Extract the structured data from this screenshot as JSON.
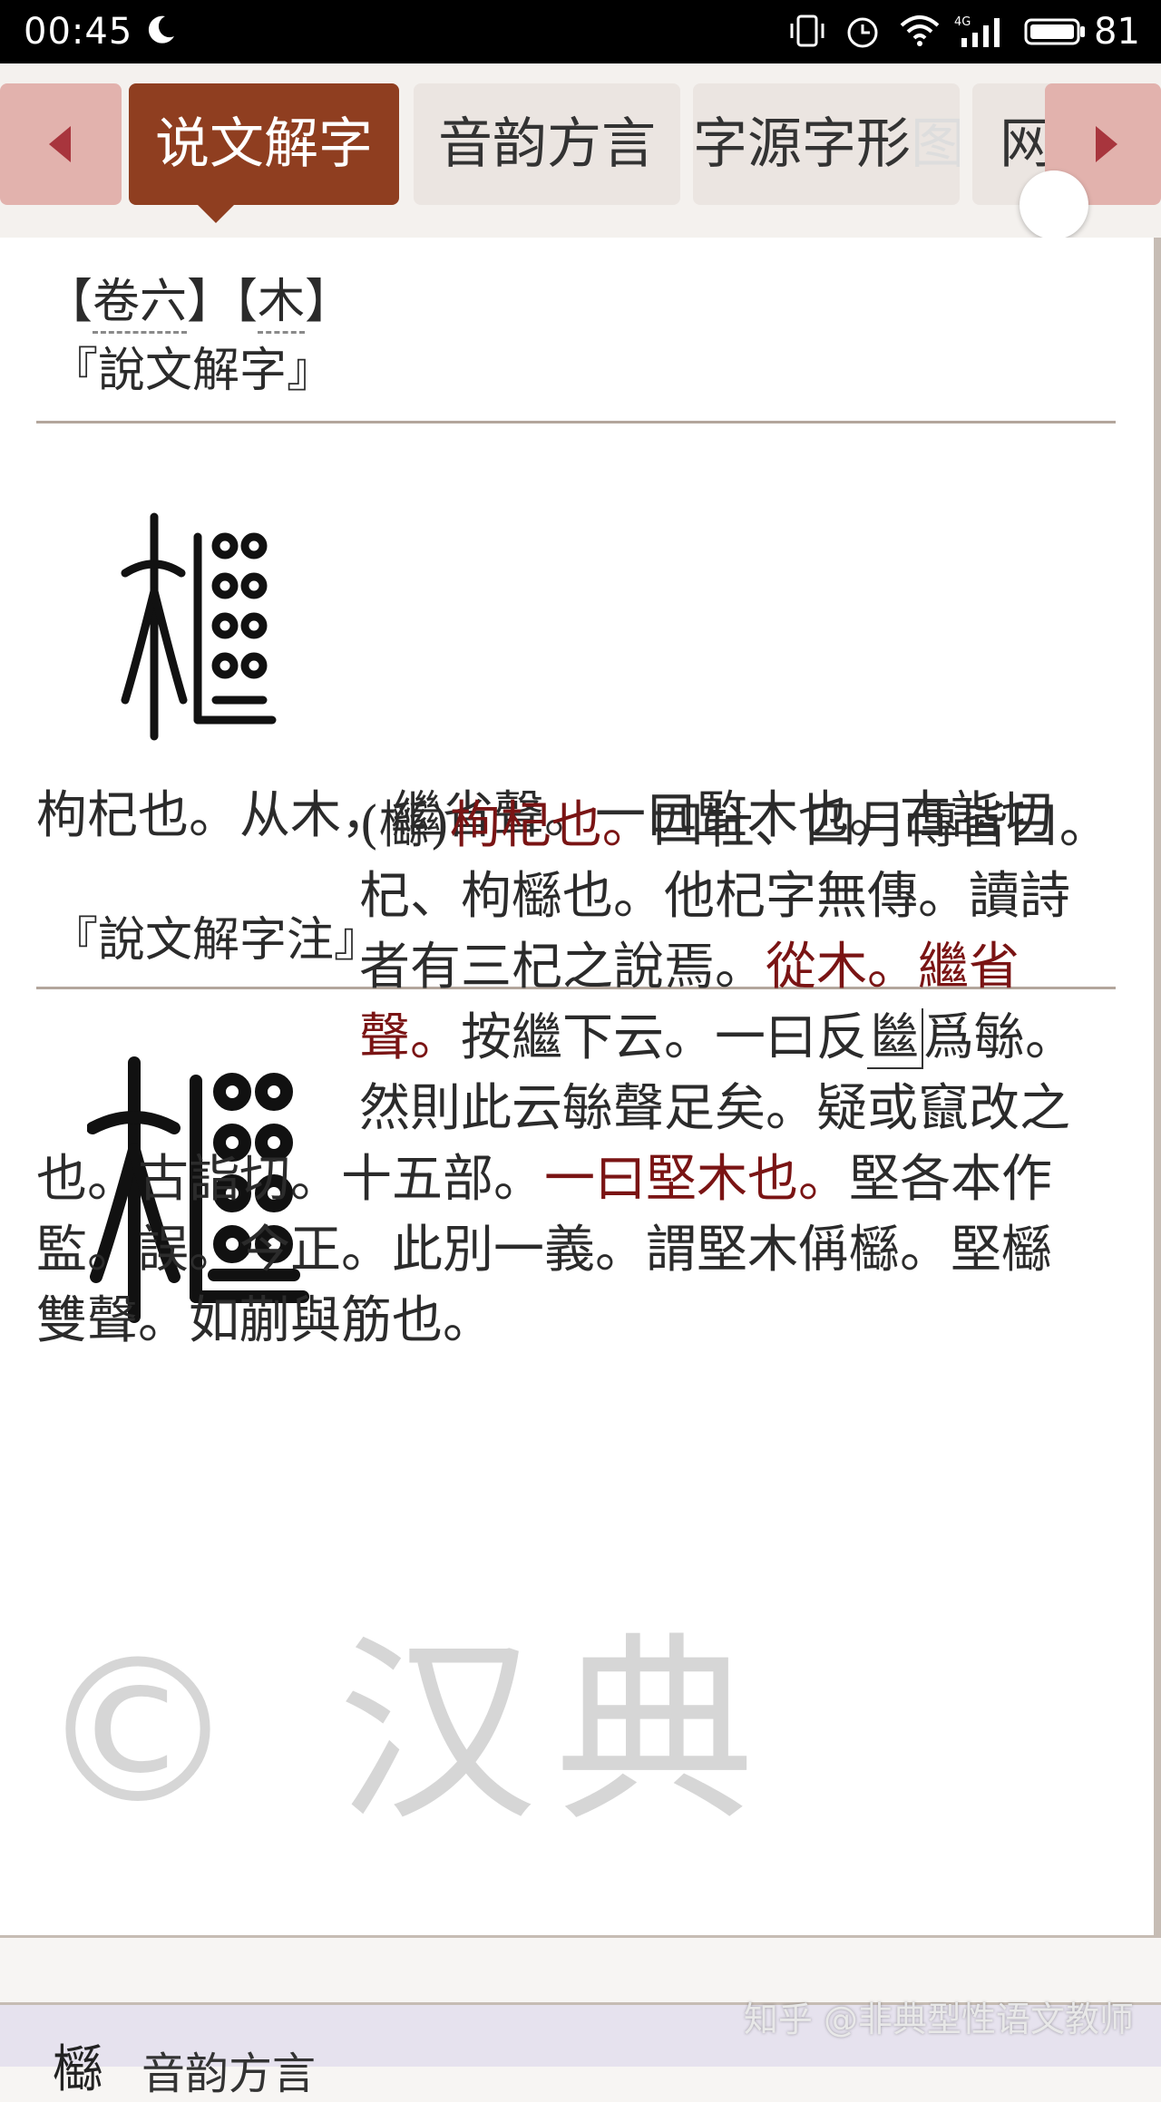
{
  "status_bar": {
    "time": "00:45",
    "battery": "81",
    "network_label": "4G",
    "icons": [
      "moon-icon",
      "vibrate-icon",
      "alarm-icon",
      "wifi-icon",
      "signal-icon",
      "battery-icon"
    ]
  },
  "tabs": {
    "items": [
      {
        "label": "说文解字",
        "active": true
      },
      {
        "label": "音韵方言",
        "active": false
      },
      {
        "label": "字源字形",
        "active": false
      },
      {
        "label": "图",
        "active": false
      },
      {
        "label": "网",
        "active": false
      }
    ],
    "prev_icon": "chevron-left-icon",
    "next_icon": "chevron-right-icon"
  },
  "entry": {
    "breadcrumb": {
      "juan": "卷六",
      "radical": "木"
    },
    "shuowen_title": "『說文解字』",
    "seal_char": "櫾",
    "definition": "枸杞也。从木，繼省聲。一曰監木也。古詣切",
    "zhu_title": "『說文解字注』",
    "zhu_lines": [
      [
        {
          "t": "(櫾)",
          "red": false
        },
        {
          "t": "枸杞也。",
          "red": true
        },
        {
          "t": "四牡、四月傳皆曰。",
          "red": false
        }
      ],
      [
        {
          "t": "杞、枸櫾也。他杞字無傳。讀詩",
          "red": false
        }
      ],
      [
        {
          "t": "者有三杞之說焉。",
          "red": false
        },
        {
          "t": "從木。繼省",
          "red": true
        }
      ],
      [
        {
          "t": "聲。",
          "red": true
        },
        {
          "t": "按繼下云。一曰反",
          "red": false
        },
        {
          "t": "㡭",
          "red": false,
          "boxed": true
        },
        {
          "t": "爲",
          "red": false
        },
        {
          "t": "䋣",
          "red": false
        },
        {
          "t": "。",
          "red": false
        }
      ],
      [
        {
          "t": "然則此云",
          "red": false
        },
        {
          "t": "䋣",
          "red": false
        },
        {
          "t": "聲足矣。疑或竄改之",
          "red": false
        }
      ],
      [
        {
          "t": "也。古詣切。十五部。",
          "red": false
        },
        {
          "t": "一曰堅木也。",
          "red": true
        },
        {
          "t": "堅各本作",
          "red": false
        }
      ],
      [
        {
          "t": "監。誤。今正。此別一義。謂堅木偁櫾。堅櫾",
          "red": false
        }
      ],
      [
        {
          "t": "雙聲。如蒯與筋也。",
          "red": false
        }
      ]
    ]
  },
  "watermark": "© 汉典",
  "credit": "知乎 @非典型性语文教师",
  "next_section": {
    "char": "櫾",
    "label": "音韵方言"
  }
}
